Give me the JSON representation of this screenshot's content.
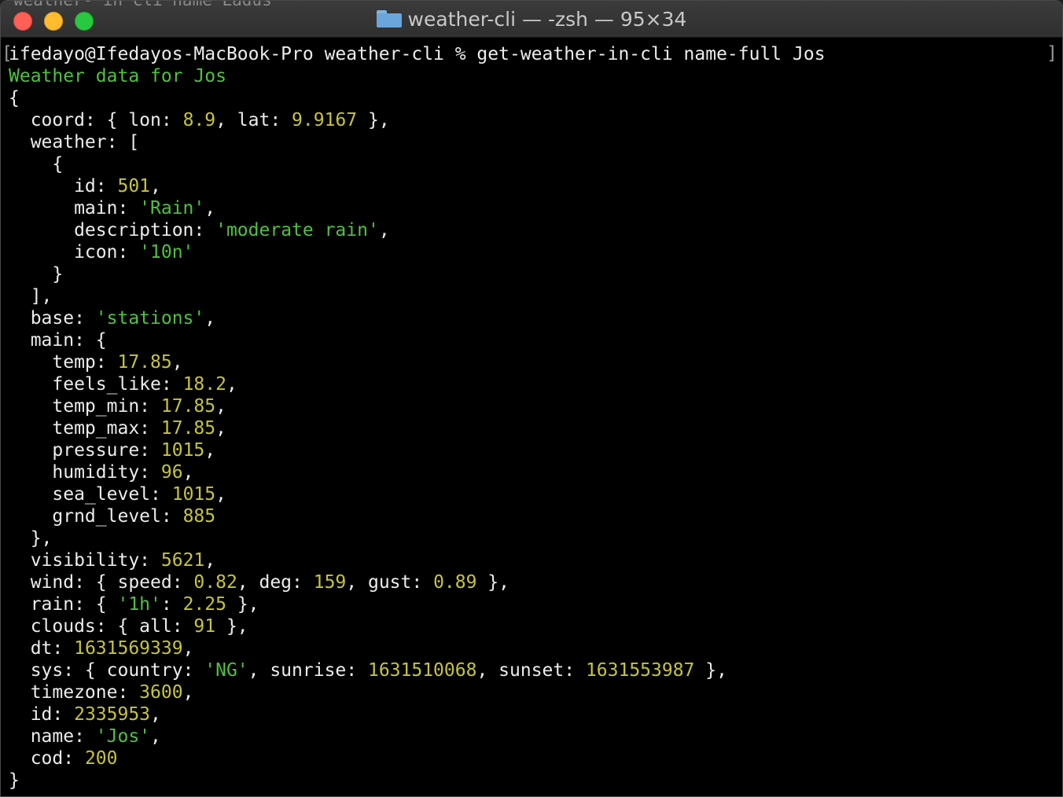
{
  "window": {
    "title": "weather-cli — -zsh — 95×34",
    "ghost_text": "weather- in cli name Ladus",
    "icon": "folder-icon",
    "controls": [
      "close",
      "minimize",
      "zoom"
    ]
  },
  "terminal": {
    "prompt": "ifedayo@Ifedayos-MacBook-Pro weather-cli % get-weather-in-cli name-full Jos",
    "header": "Weather data for Jos",
    "lines": [
      [
        [
          "p",
          "{"
        ]
      ],
      [
        [
          "p",
          "  coord: { lon: "
        ],
        [
          "n",
          "8.9"
        ],
        [
          "p",
          ", lat: "
        ],
        [
          "n",
          "9.9167"
        ],
        [
          "p",
          " },"
        ]
      ],
      [
        [
          "p",
          "  weather: ["
        ]
      ],
      [
        [
          "p",
          "    {"
        ]
      ],
      [
        [
          "p",
          "      id: "
        ],
        [
          "n",
          "501"
        ],
        [
          "p",
          ","
        ]
      ],
      [
        [
          "p",
          "      main: "
        ],
        [
          "s",
          "'Rain'"
        ],
        [
          "p",
          ","
        ]
      ],
      [
        [
          "p",
          "      description: "
        ],
        [
          "s",
          "'moderate rain'"
        ],
        [
          "p",
          ","
        ]
      ],
      [
        [
          "p",
          "      icon: "
        ],
        [
          "s",
          "'10n'"
        ]
      ],
      [
        [
          "p",
          "    }"
        ]
      ],
      [
        [
          "p",
          "  ],"
        ]
      ],
      [
        [
          "p",
          "  base: "
        ],
        [
          "s",
          "'stations'"
        ],
        [
          "p",
          ","
        ]
      ],
      [
        [
          "p",
          "  main: {"
        ]
      ],
      [
        [
          "p",
          "    temp: "
        ],
        [
          "n",
          "17.85"
        ],
        [
          "p",
          ","
        ]
      ],
      [
        [
          "p",
          "    feels_like: "
        ],
        [
          "n",
          "18.2"
        ],
        [
          "p",
          ","
        ]
      ],
      [
        [
          "p",
          "    temp_min: "
        ],
        [
          "n",
          "17.85"
        ],
        [
          "p",
          ","
        ]
      ],
      [
        [
          "p",
          "    temp_max: "
        ],
        [
          "n",
          "17.85"
        ],
        [
          "p",
          ","
        ]
      ],
      [
        [
          "p",
          "    pressure: "
        ],
        [
          "n",
          "1015"
        ],
        [
          "p",
          ","
        ]
      ],
      [
        [
          "p",
          "    humidity: "
        ],
        [
          "n",
          "96"
        ],
        [
          "p",
          ","
        ]
      ],
      [
        [
          "p",
          "    sea_level: "
        ],
        [
          "n",
          "1015"
        ],
        [
          "p",
          ","
        ]
      ],
      [
        [
          "p",
          "    grnd_level: "
        ],
        [
          "n",
          "885"
        ]
      ],
      [
        [
          "p",
          "  },"
        ]
      ],
      [
        [
          "p",
          "  visibility: "
        ],
        [
          "n",
          "5621"
        ],
        [
          "p",
          ","
        ]
      ],
      [
        [
          "p",
          "  wind: { speed: "
        ],
        [
          "n",
          "0.82"
        ],
        [
          "p",
          ", deg: "
        ],
        [
          "n",
          "159"
        ],
        [
          "p",
          ", gust: "
        ],
        [
          "n",
          "0.89"
        ],
        [
          "p",
          " },"
        ]
      ],
      [
        [
          "p",
          "  rain: { "
        ],
        [
          "s",
          "'1h'"
        ],
        [
          "p",
          ": "
        ],
        [
          "n",
          "2.25"
        ],
        [
          "p",
          " },"
        ]
      ],
      [
        [
          "p",
          "  clouds: { all: "
        ],
        [
          "n",
          "91"
        ],
        [
          "p",
          " },"
        ]
      ],
      [
        [
          "p",
          "  dt: "
        ],
        [
          "n",
          "1631569339"
        ],
        [
          "p",
          ","
        ]
      ],
      [
        [
          "p",
          "  sys: { country: "
        ],
        [
          "s",
          "'NG'"
        ],
        [
          "p",
          ", sunrise: "
        ],
        [
          "n",
          "1631510068"
        ],
        [
          "p",
          ", sunset: "
        ],
        [
          "n",
          "1631553987"
        ],
        [
          "p",
          " },"
        ]
      ],
      [
        [
          "p",
          "  timezone: "
        ],
        [
          "n",
          "3600"
        ],
        [
          "p",
          ","
        ]
      ],
      [
        [
          "p",
          "  id: "
        ],
        [
          "n",
          "2335953"
        ],
        [
          "p",
          ","
        ]
      ],
      [
        [
          "p",
          "  name: "
        ],
        [
          "s",
          "'Jos'"
        ],
        [
          "p",
          ","
        ]
      ],
      [
        [
          "p",
          "  cod: "
        ],
        [
          "n",
          "200"
        ]
      ],
      [
        [
          "p",
          "}"
        ]
      ]
    ]
  },
  "colors": {
    "background": "#000000",
    "text": "#ececec",
    "number": "#c7c43c",
    "string": "#4fc23f"
  }
}
